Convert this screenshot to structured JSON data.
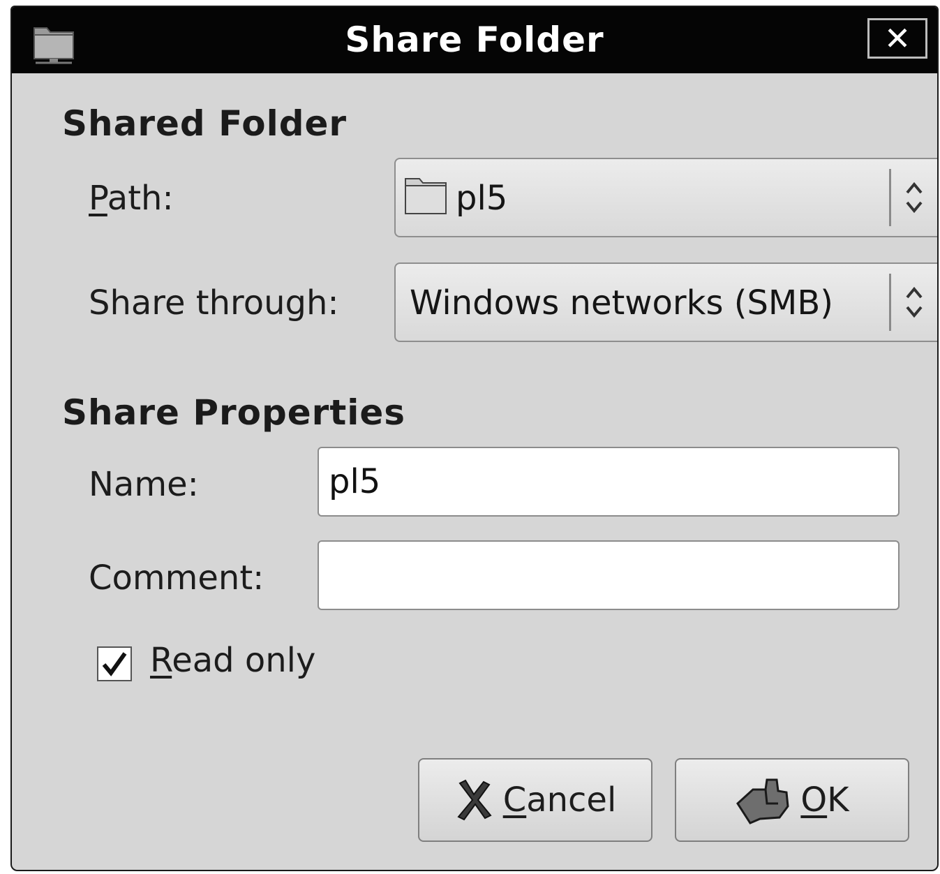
{
  "window": {
    "title": "Share Folder",
    "close_glyph": "✕"
  },
  "shared_folder": {
    "heading": "Shared Folder",
    "path_label_mnemonic": "P",
    "path_label_rest": "ath:",
    "path_value": "pl5",
    "path_icon": "folder-icon",
    "share_through_label": "Share through:",
    "share_through_value": "Windows networks (SMB)"
  },
  "share_properties": {
    "heading": "Share Properties",
    "name_label": "Name:",
    "name_value": "pl5",
    "comment_label": "Comment:",
    "comment_value": "",
    "read_only_mnemonic": "R",
    "read_only_rest": "ead only",
    "read_only_checked": true
  },
  "buttons": {
    "cancel_mnemonic": "C",
    "cancel_rest": "ancel",
    "cancel_icon": "cancel-x-icon",
    "ok_mnemonic": "O",
    "ok_rest": "K",
    "ok_icon": "ok-hand-icon"
  }
}
